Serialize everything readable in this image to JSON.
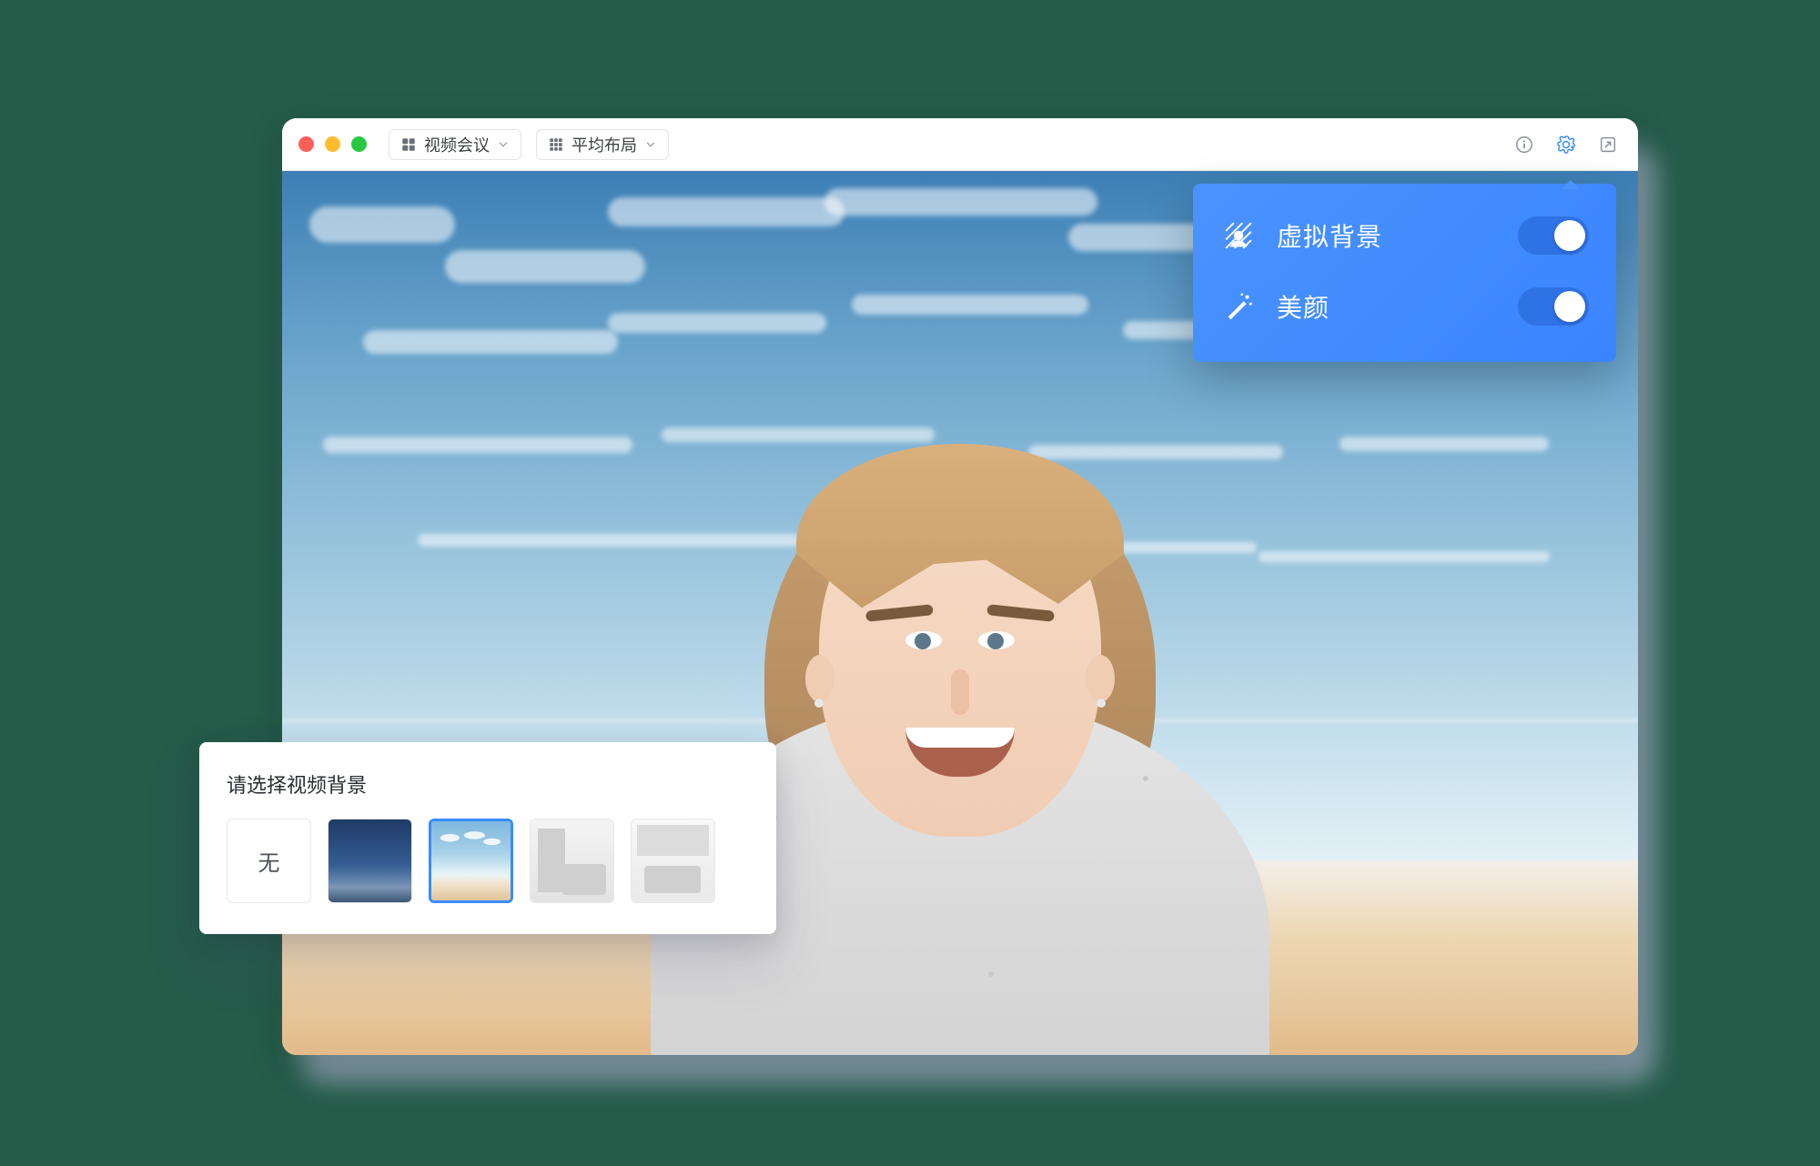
{
  "titlebar": {
    "mode_label": "视频会议",
    "layout_label": "平均布局"
  },
  "popover": {
    "items": [
      {
        "id": "virtual-bg",
        "label": "虚拟背景",
        "on": true
      },
      {
        "id": "beauty",
        "label": "美颜",
        "on": true
      }
    ]
  },
  "bg_picker": {
    "title": "请选择视频背景",
    "none_label": "无",
    "options": [
      {
        "id": "none",
        "kind": "none",
        "selected": false
      },
      {
        "id": "sky1",
        "kind": "image",
        "selected": false
      },
      {
        "id": "sky2",
        "kind": "image",
        "selected": true
      },
      {
        "id": "room1",
        "kind": "image",
        "selected": false
      },
      {
        "id": "room2",
        "kind": "image",
        "selected": false
      }
    ]
  }
}
